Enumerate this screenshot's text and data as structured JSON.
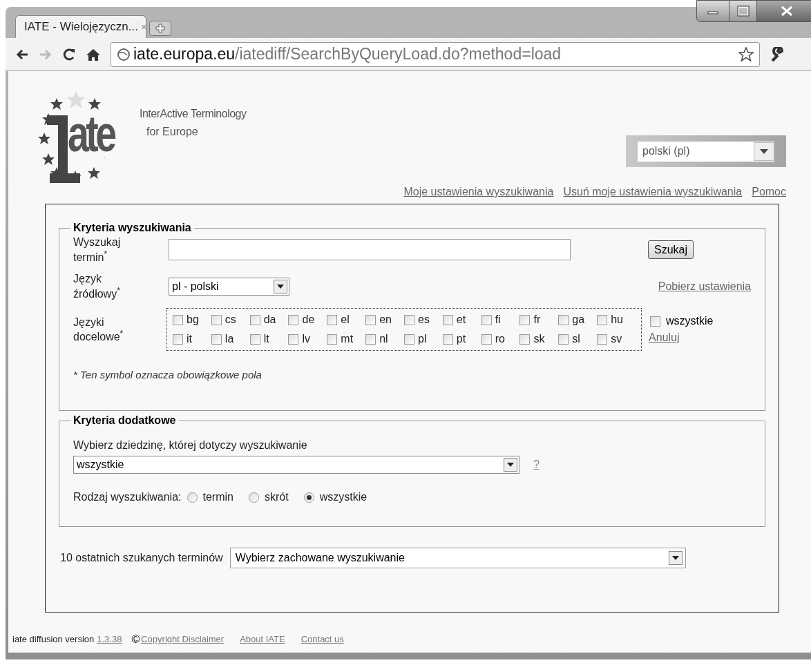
{
  "browser": {
    "tab_title": "IATE - Wielojęzyczn...",
    "tab_close": "×",
    "address_host": "iate.europa.eu",
    "address_path": "/iatediff/SearchByQueryLoad.do?method=load",
    "forward_disabled": true
  },
  "header": {
    "logo_mark": "ate",
    "tagline_line_1": "InterActive Terminology",
    "tagline_line_2": "for Europe",
    "interface_language": "polski (pl)",
    "links": [
      "Moje ustawienia wyszukiwania",
      "Usuń moje ustawienia wyszukiwania",
      "Pomoc"
    ]
  },
  "criteria": {
    "legend": "Kryteria wyszukiwania",
    "term_label": "Wyszukaj termin$^{*}$",
    "search_button": "Szukaj",
    "source_label": "Język źródłowy$^{*}$",
    "source_language": "pl - polski",
    "load_settings_link": "Pobierz ustawienia",
    "target_label": "Języki docelowe$^{*}$",
    "target_languages": [
      {
        "code": "bg",
        "checked": false
      },
      {
        "code": "cs",
        "checked": false
      },
      {
        "code": "da",
        "checked": false
      },
      {
        "code": "de",
        "checked": false
      },
      {
        "code": "el",
        "checked": false
      },
      {
        "code": "en",
        "checked": false
      },
      {
        "code": "es",
        "checked": false
      },
      {
        "code": "et",
        "checked": false
      },
      {
        "code": "fi",
        "checked": false
      },
      {
        "code": "fr",
        "checked": false
      },
      {
        "code": "ga",
        "checked": false
      },
      {
        "code": "hu",
        "checked": false
      },
      {
        "code": "it",
        "checked": false
      },
      {
        "code": "la",
        "checked": false
      },
      {
        "code": "lt",
        "checked": false
      },
      {
        "code": "lv",
        "checked": false
      },
      {
        "code": "mt",
        "checked": false
      },
      {
        "code": "nl",
        "checked": false
      },
      {
        "code": "pl",
        "checked": false
      },
      {
        "code": "pt",
        "checked": false
      },
      {
        "code": "ro",
        "checked": false
      },
      {
        "code": "sk",
        "checked": false
      },
      {
        "code": "sl",
        "checked": false
      },
      {
        "code": "sv",
        "checked": false
      }
    ],
    "all_languages": {
      "label": "wszystkie",
      "checked": false
    },
    "cancel_link": "Anuluj",
    "note": "* Ten symbol oznacza obowiązkowe pola"
  },
  "additional": {
    "legend": "Kryteria dodatkowe",
    "domain_label": "Wybierz dziedzinę, której dotyczy wyszukiwanie",
    "domain": "wszystkie",
    "help_link": "?",
    "search_type_label": "Rodzaj wyszukiwania:",
    "search_types": [
      {
        "label": "termin",
        "selected": false
      },
      {
        "label": "skrót",
        "selected": false
      },
      {
        "label": "wszystkie",
        "selected": true
      }
    ]
  },
  "recent": {
    "label": "10 ostatnich szukanych terminów",
    "value": "Wybierz zachowane wyszukiwanie"
  },
  "footer": {
    "version_text": "iate diffusion version",
    "version_link": "1.3.38",
    "copyright_symbol": "©",
    "links": [
      "Copyright Disclaimer",
      "About IATE",
      "Contact us"
    ]
  }
}
